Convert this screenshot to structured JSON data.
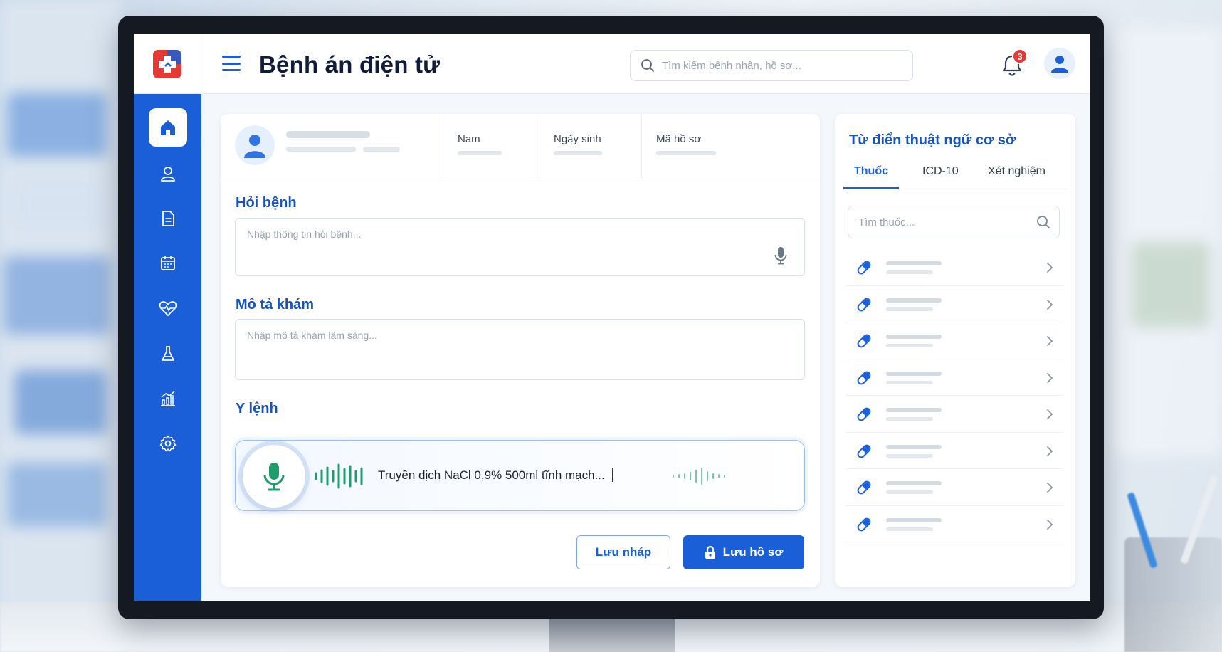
{
  "header": {
    "title": "Bệnh án điện tử",
    "search_placeholder": "Tìm kiếm bệnh nhân, hồ sơ...",
    "notification_count": "3"
  },
  "sidebar": {
    "items": [
      {
        "icon": "home-icon",
        "active": true
      },
      {
        "icon": "user-icon",
        "active": false
      },
      {
        "icon": "document-icon",
        "active": false
      },
      {
        "icon": "calendar-icon",
        "active": false
      },
      {
        "icon": "heart-pulse-icon",
        "active": false
      },
      {
        "icon": "flask-icon",
        "active": false
      },
      {
        "icon": "chart-icon",
        "active": false
      },
      {
        "icon": "gear-icon",
        "active": false
      }
    ]
  },
  "patient": {
    "gender_label": "Nam",
    "dob_label": "Ngày sinh",
    "record_label": "Mã hồ sơ"
  },
  "form": {
    "history_title": "Hỏi bệnh",
    "history_placeholder": "Nhập thông tin hỏi bệnh...",
    "exam_title": "Mô tả khám",
    "exam_placeholder": "Nhập mô tả khám lâm sàng...",
    "orders_title": "Y lệnh",
    "voice_text": "Truyền dịch NaCl 0,9% 500ml tĩnh mạch...",
    "draft_button": "Lưu nháp",
    "save_button": "Lưu hồ sơ"
  },
  "dictionary": {
    "title": "Từ điển thuật ngữ cơ sở",
    "tabs": [
      "Thuốc",
      "ICD-10",
      "Xét nghiệm"
    ],
    "active_tab": 0,
    "search_placeholder": "Tìm thuốc...",
    "item_count": 8
  },
  "colors": {
    "primary": "#1a5fd8",
    "heading": "#1853b8",
    "voice_accent": "#1f9d6b",
    "badge": "#e53935"
  }
}
